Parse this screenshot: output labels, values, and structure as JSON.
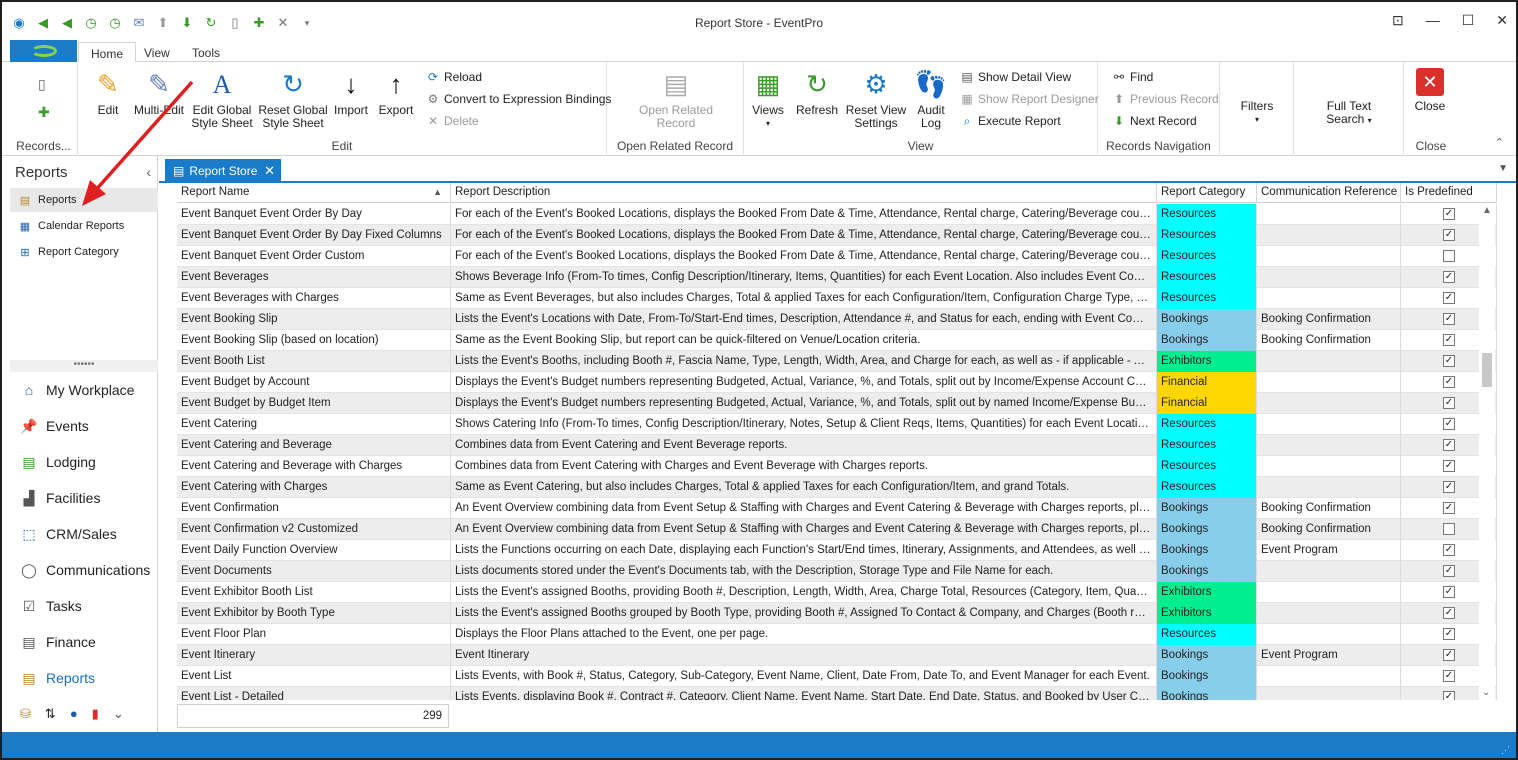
{
  "window": {
    "title": "Report Store - EventPro"
  },
  "ribbon_tabs": [
    "Home",
    "View",
    "Tools"
  ],
  "ribbon": {
    "records": {
      "label": "Records..."
    },
    "edit_group": {
      "label": "Edit",
      "edit": "Edit",
      "multi_edit": "Multi-Edit",
      "edit_global_style": [
        "Edit Global",
        "Style Sheet"
      ],
      "reset_global_style": [
        "Reset Global",
        "Style Sheet"
      ],
      "import": "Import",
      "export": "Export",
      "reload": "Reload",
      "convert": "Convert to Expression Bindings",
      "delete": "Delete"
    },
    "open_related_group": {
      "label": "Open Related Record",
      "button": [
        "Open Related",
        "Record"
      ]
    },
    "view_group": {
      "label": "View",
      "views": "Views",
      "refresh": "Refresh",
      "reset_view": [
        "Reset View",
        "Settings"
      ],
      "audit": [
        "Audit",
        "Log"
      ],
      "show_detail": "Show Detail View",
      "show_designer": "Show Report Designer",
      "execute": "Execute Report"
    },
    "nav_group": {
      "label": "Records Navigation",
      "find": "Find",
      "previous": "Previous Record",
      "next": "Next Record"
    },
    "filters": "Filters",
    "full_text": [
      "Full Text",
      "Search"
    ],
    "close_group": {
      "label": "Close",
      "close": "Close"
    }
  },
  "sidebar": {
    "header": "Reports",
    "items": [
      {
        "label": "Reports",
        "icon": "reports-icon"
      },
      {
        "label": "Calendar Reports",
        "icon": "calendar-icon"
      },
      {
        "label": "Report Category",
        "icon": "category-icon"
      }
    ],
    "nav": [
      {
        "label": "My Workplace",
        "icon": "home-icon"
      },
      {
        "label": "Events",
        "icon": "pin-icon"
      },
      {
        "label": "Lodging",
        "icon": "bed-icon"
      },
      {
        "label": "Facilities",
        "icon": "facility-icon"
      },
      {
        "label": "CRM/Sales",
        "icon": "crm-icon"
      },
      {
        "label": "Communications",
        "icon": "chat-icon"
      },
      {
        "label": "Tasks",
        "icon": "tasks-icon"
      },
      {
        "label": "Finance",
        "icon": "finance-icon"
      },
      {
        "label": "Reports",
        "icon": "reports-icon"
      }
    ]
  },
  "doc_tab": {
    "label": "Report Store"
  },
  "grid": {
    "columns": [
      "Report Name",
      "Report Description",
      "Report Category",
      "Communication Reference",
      "Is Predefined"
    ],
    "category_colors": {
      "Resources": "#00ffff",
      "Bookings": "#87ceeb",
      "Exhibitors": "#00ee90",
      "Financial": "#ffd700"
    },
    "rows": [
      {
        "name": "Event Banquet Event Order By Day",
        "desc": "For each of the Event's Booked Locations, displays the Booked From Date & Time, Attendance, Rental charge, Catering/Beverage counts & req...",
        "cat": "Resources",
        "ref": "",
        "pre": true
      },
      {
        "name": "Event Banquet Event Order By Day Fixed Columns",
        "desc": "For each of the Event's Booked Locations, displays the Booked From Date & Time, Attendance, Rental charge, Catering/Beverage counts & req...",
        "cat": "Resources",
        "ref": "",
        "pre": true
      },
      {
        "name": "Event Banquet Event Order Custom",
        "desc": "For each of the Event's Booked Locations, displays the Booked From Date & Time, Attendance, Rental charge, Catering/Beverage counts & req...",
        "cat": "Resources",
        "ref": "",
        "pre": false
      },
      {
        "name": "Event Beverages",
        "desc": "Shows Beverage Info (From-To times, Config Description/Itinerary, Items, Quantities) for each Event Location. Also includes Event Comments, ...",
        "cat": "Resources",
        "ref": "",
        "pre": true
      },
      {
        "name": "Event Beverages with Charges",
        "desc": "Same as Event Beverages, but also includes Charges, Total & applied Taxes for each Configuration/Item, Configuration Charge Type, and gran...",
        "cat": "Resources",
        "ref": "",
        "pre": true
      },
      {
        "name": "Event Booking Slip",
        "desc": "Lists the Event's Locations with Date, From-To/Start-End times, Description, Attendance #, and Status for each, ending with Event Comments ...",
        "cat": "Bookings",
        "ref": "Booking Confirmation",
        "pre": true
      },
      {
        "name": "Event Booking Slip (based on location)",
        "desc": "Same as the Event Booking Slip, but report can be quick-filtered on Venue/Location criteria.",
        "cat": "Bookings",
        "ref": "Booking Confirmation",
        "pre": true
      },
      {
        "name": "Event Booth List",
        "desc": "Lists the Event's Booths, including Booth #, Fascia Name, Type, Length, Width, Area, and Charge for each, as well as - if applicable - Assigned ...",
        "cat": "Exhibitors",
        "ref": "",
        "pre": true
      },
      {
        "name": "Event Budget by Account",
        "desc": "Displays the Event's Budget numbers representing Budgeted, Actual, Variance, %, and Totals, split out by Income/Expense Account Codes.",
        "cat": "Financial",
        "ref": "",
        "pre": true
      },
      {
        "name": "Event Budget by Budget Item",
        "desc": "Displays the Event's Budget numbers representing Budgeted, Actual, Variance, %, and Totals, split out by named Income/Expense Budget Ite...",
        "cat": "Financial",
        "ref": "",
        "pre": true
      },
      {
        "name": "Event Catering",
        "desc": "Shows Catering Info (From-To times, Config Description/Itinerary, Notes, Setup & Client Reqs, Items, Quantities) for each Event Location. Also...",
        "cat": "Resources",
        "ref": "",
        "pre": true
      },
      {
        "name": "Event Catering and Beverage",
        "desc": "Combines data from Event Catering and Event Beverage reports.",
        "cat": "Resources",
        "ref": "",
        "pre": true
      },
      {
        "name": "Event Catering and Beverage with Charges",
        "desc": "Combines data from Event Catering with Charges and Event Beverage with Charges reports.",
        "cat": "Resources",
        "ref": "",
        "pre": true
      },
      {
        "name": "Event Catering with Charges",
        "desc": "Same as Event Catering, but also includes Charges, Total & applied Taxes for each Configuration/Item, and grand Totals.",
        "cat": "Resources",
        "ref": "",
        "pre": true
      },
      {
        "name": "Event Confirmation",
        "desc": "An Event Overview combining data from Event Setup & Staffing with Charges and Event Catering & Beverage with Charges reports, plus addin...",
        "cat": "Bookings",
        "ref": "Booking Confirmation",
        "pre": true
      },
      {
        "name": "Event Confirmation v2 Customized",
        "desc": "An Event Overview combining data from Event Setup & Staffing with Charges and Event Catering & Beverage with Charges reports, plus addin...",
        "cat": "Bookings",
        "ref": "Booking Confirmation",
        "pre": false
      },
      {
        "name": "Event Daily Function Overview",
        "desc": "Lists the Functions occurring on each Date, displaying each Function's Start/End times, Itinerary, Assignments, and Attendees, as well as the B...",
        "cat": "Bookings",
        "ref": "Event Program",
        "pre": true
      },
      {
        "name": "Event Documents",
        "desc": "Lists documents stored under the Event's Documents tab, with the Description, Storage Type and File Name for each.",
        "cat": "Bookings",
        "ref": "",
        "pre": true
      },
      {
        "name": "Event Exhibitor Booth List",
        "desc": "Lists the Event's assigned Booths, providing Booth #, Description, Length, Width, Area, Charge Total, Resources (Category, Item, Quantity, C...",
        "cat": "Exhibitors",
        "ref": "",
        "pre": true
      },
      {
        "name": "Event Exhibitor by Booth Type",
        "desc": "Lists the Event's assigned Booths grouped by Booth Type, providing Booth #, Assigned To Contact  & Company, and Charges (Booth rental, Se...",
        "cat": "Exhibitors",
        "ref": "",
        "pre": true
      },
      {
        "name": "Event Floor Plan",
        "desc": "Displays the Floor Plans attached to the Event, one per page.",
        "cat": "Resources",
        "ref": "",
        "pre": true
      },
      {
        "name": "Event Itinerary",
        "desc": "Event Itinerary",
        "cat": "Bookings",
        "ref": "Event Program",
        "pre": true
      },
      {
        "name": "Event List",
        "desc": "Lists Events, with Book #, Status, Category, Sub-Category, Event Name, Client, Date From, Date To, and Event Manager for each Event.",
        "cat": "Bookings",
        "ref": "",
        "pre": true
      },
      {
        "name": "Event List - Detailed",
        "desc": "Lists Events, displaying Book #, Contract #, Category, Client Name, Event Name, Start Date, End Date, Status, and Booked by User Code for ...",
        "cat": "Bookings",
        "ref": "",
        "pre": true
      }
    ],
    "count": "299"
  }
}
